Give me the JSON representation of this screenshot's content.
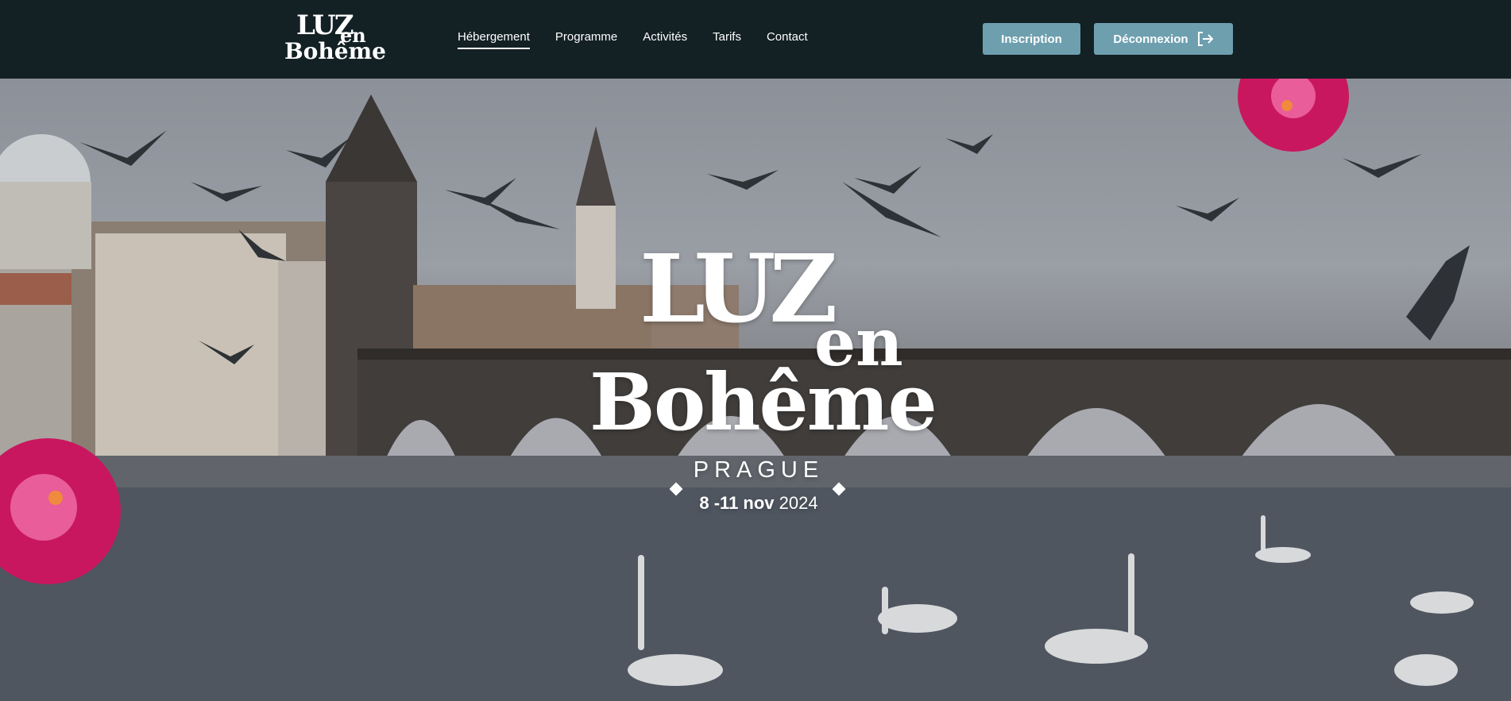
{
  "logo": {
    "line1": "LUZ",
    "line2": "en",
    "line3": "Bohême"
  },
  "nav": [
    {
      "label": "Hébergement",
      "active": true
    },
    {
      "label": "Programme"
    },
    {
      "label": "Activités"
    },
    {
      "label": "Tarifs"
    },
    {
      "label": "Contact"
    }
  ],
  "buttons": {
    "signup": "Inscription",
    "logout": "Déconnexion"
  },
  "hero": {
    "title_luz": "LUZ",
    "title_en": "en",
    "title_boheme": "Bohême",
    "city": "PRAGUE",
    "dates": "8 -11 nov",
    "year": "2024"
  },
  "colors": {
    "header_bg": "#132024",
    "button_bg": "#6e9faf",
    "flower": "#c8175f"
  },
  "icons": {
    "logout": "logout-arrow-icon"
  }
}
